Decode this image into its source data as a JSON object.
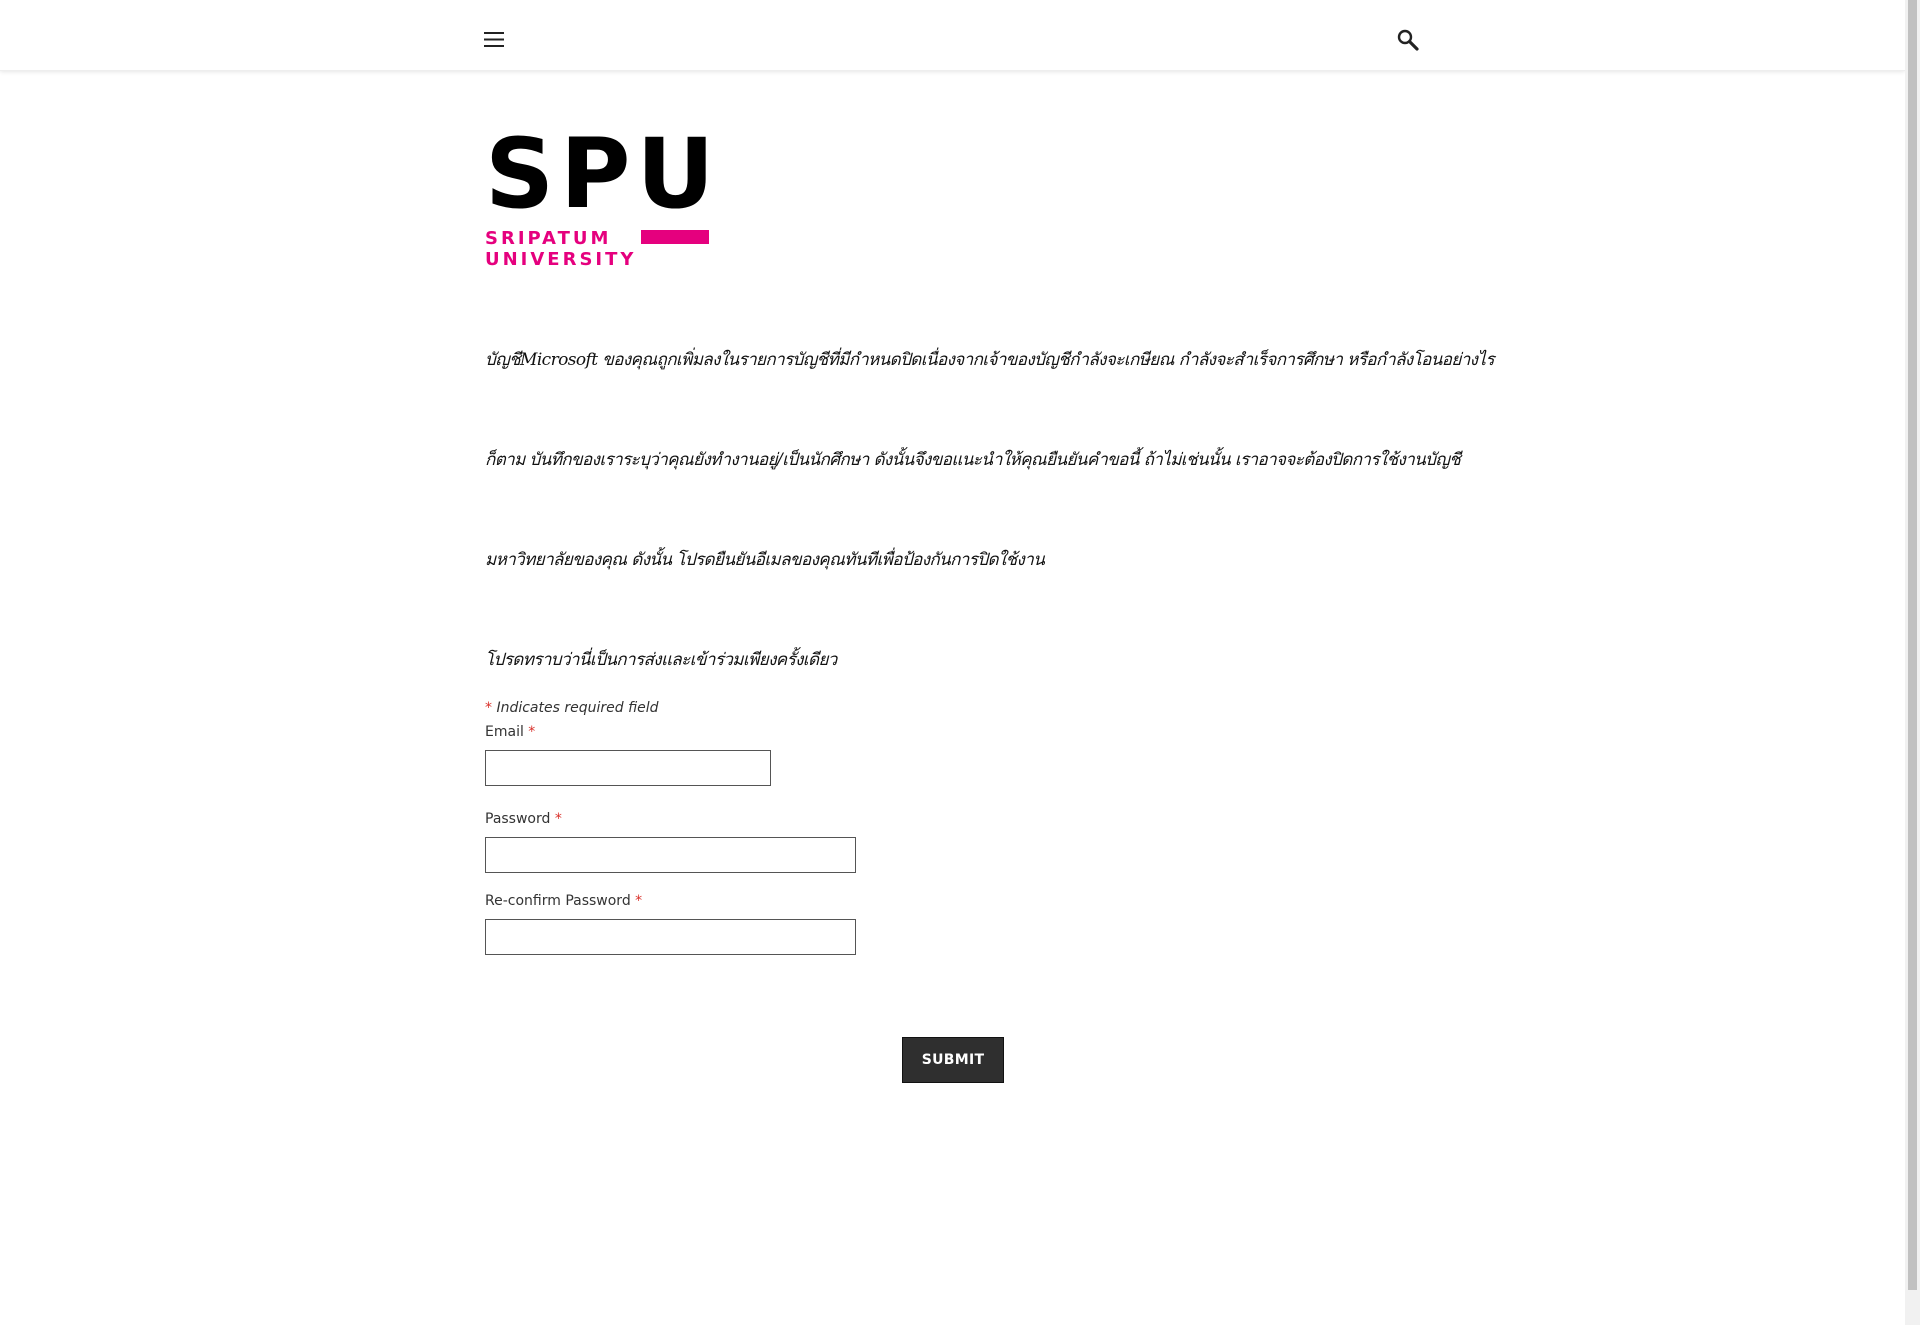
{
  "header": {
    "menu_icon": "hamburger-menu-icon",
    "search_icon": "magnifier-search-icon"
  },
  "logo": {
    "letters": "SPU",
    "line1": "SRIPATUM",
    "line2": "UNIVERSITY",
    "accent_color": "#e5007e"
  },
  "notice": {
    "line1": "บัญชีMicrosoft ของคุณถูกเพิ่มลงในรายการบัญชีที่มีกำหนดปิดเนื่องจากเจ้าของบัญชีกำลังจะเกษียณ กำลังจะสำเร็จการศึกษา หรือกำลังโอนอย่างไร",
    "line2": "ก็ตาม บันทึกของเราระบุว่าคุณยังทำงานอยู่/เป็นนักศึกษา ดังนั้นจึงขอแนะนำให้คุณยืนยันคำขอนี้ ถ้าไม่เช่นนั้น เราอาจจะต้องปิดการใช้งานบัญชี",
    "line3": "มหาวิทยาลัยของคุณ ดังนั้น โปรดยืนยันอีเมลของคุณทันทีเพื่อป้องกันการปิดใช้งาน",
    "line4": "โปรดทราบว่านี่เป็นการส่งและเข้าร่วมเพียงครั้งเดียว"
  },
  "form": {
    "required_mark": "*",
    "required_note": "Indicates required field",
    "email_label": "Email",
    "email_value": "",
    "password_label": "Password",
    "password_value": "",
    "reconfirm_label": "Re-confirm Password",
    "reconfirm_value": "",
    "submit_label": "SUBMIT"
  }
}
